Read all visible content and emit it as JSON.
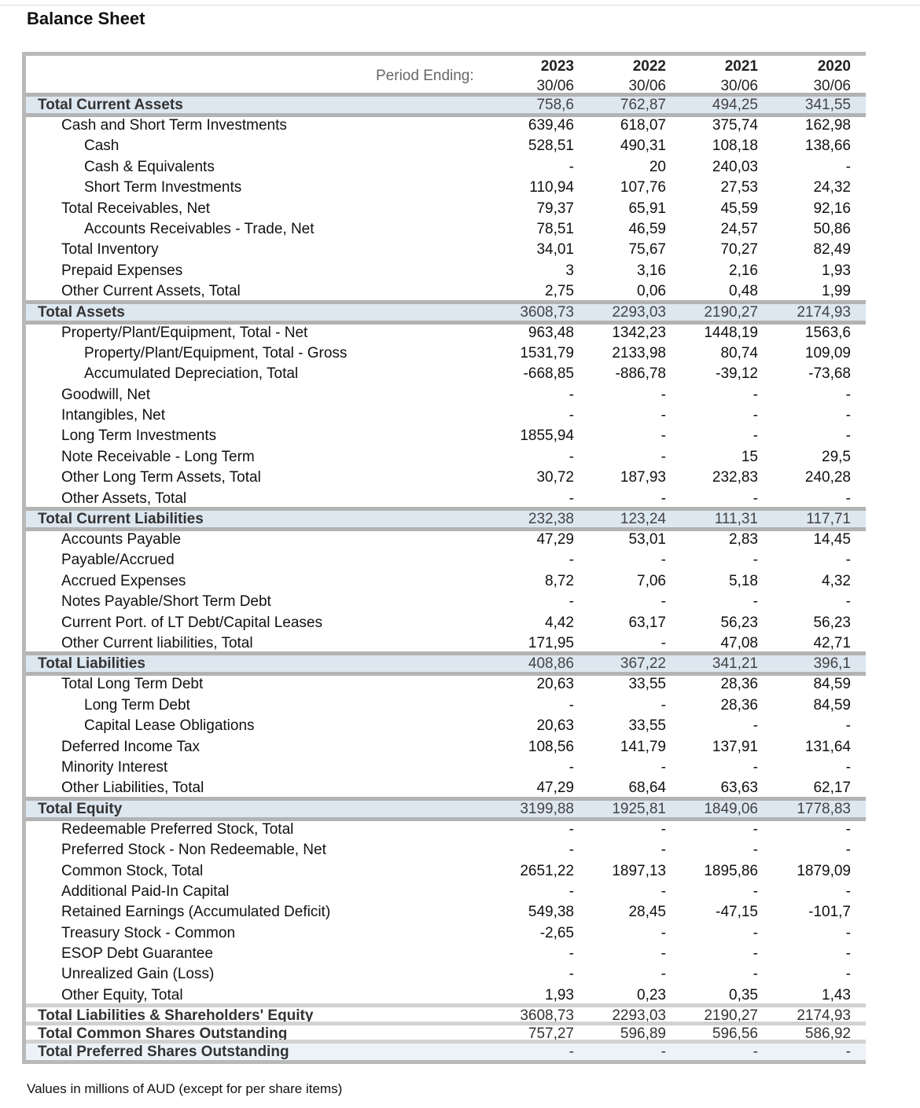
{
  "title": "Balance Sheet",
  "period_label": "Period Ending:",
  "periods": [
    {
      "year": "2023",
      "date": "30/06"
    },
    {
      "year": "2022",
      "date": "30/06"
    },
    {
      "year": "2021",
      "date": "30/06"
    },
    {
      "year": "2020",
      "date": "30/06"
    }
  ],
  "rows": [
    {
      "label": "Total Current Assets",
      "level": 0,
      "style": "sec",
      "values": [
        "758,6",
        "762,87",
        "494,25",
        "341,55"
      ]
    },
    {
      "label": "Cash and Short Term Investments",
      "level": 1,
      "values": [
        "639,46",
        "618,07",
        "375,74",
        "162,98"
      ]
    },
    {
      "label": "Cash",
      "level": 2,
      "values": [
        "528,51",
        "490,31",
        "108,18",
        "138,66"
      ]
    },
    {
      "label": "Cash & Equivalents",
      "level": 2,
      "values": [
        "-",
        "20",
        "240,03",
        "-"
      ]
    },
    {
      "label": "Short Term Investments",
      "level": 2,
      "values": [
        "110,94",
        "107,76",
        "27,53",
        "24,32"
      ]
    },
    {
      "label": "Total Receivables, Net",
      "level": 1,
      "values": [
        "79,37",
        "65,91",
        "45,59",
        "92,16"
      ]
    },
    {
      "label": "Accounts Receivables - Trade, Net",
      "level": 2,
      "values": [
        "78,51",
        "46,59",
        "24,57",
        "50,86"
      ]
    },
    {
      "label": "Total Inventory",
      "level": 1,
      "values": [
        "34,01",
        "75,67",
        "70,27",
        "82,49"
      ]
    },
    {
      "label": "Prepaid Expenses",
      "level": 1,
      "values": [
        "3",
        "3,16",
        "2,16",
        "1,93"
      ]
    },
    {
      "label": "Other Current Assets, Total",
      "level": 1,
      "values": [
        "2,75",
        "0,06",
        "0,48",
        "1,99"
      ]
    },
    {
      "label": "Total Assets",
      "level": 0,
      "style": "sec",
      "values": [
        "3608,73",
        "2293,03",
        "2190,27",
        "2174,93"
      ]
    },
    {
      "label": "Property/Plant/Equipment, Total - Net",
      "level": 1,
      "values": [
        "963,48",
        "1342,23",
        "1448,19",
        "1563,6"
      ]
    },
    {
      "label": "Property/Plant/Equipment, Total - Gross",
      "level": 2,
      "values": [
        "1531,79",
        "2133,98",
        "80,74",
        "109,09"
      ]
    },
    {
      "label": "Accumulated Depreciation, Total",
      "level": 2,
      "values": [
        "-668,85",
        "-886,78",
        "-39,12",
        "-73,68"
      ]
    },
    {
      "label": "Goodwill, Net",
      "level": 1,
      "values": [
        "-",
        "-",
        "-",
        "-"
      ]
    },
    {
      "label": "Intangibles, Net",
      "level": 1,
      "values": [
        "-",
        "-",
        "-",
        "-"
      ]
    },
    {
      "label": "Long Term Investments",
      "level": 1,
      "values": [
        "1855,94",
        "-",
        "-",
        "-"
      ]
    },
    {
      "label": "Note Receivable - Long Term",
      "level": 1,
      "values": [
        "-",
        "-",
        "15",
        "29,5"
      ]
    },
    {
      "label": "Other Long Term Assets, Total",
      "level": 1,
      "values": [
        "30,72",
        "187,93",
        "232,83",
        "240,28"
      ]
    },
    {
      "label": "Other Assets, Total",
      "level": 1,
      "values": [
        "-",
        "-",
        "-",
        "-"
      ]
    },
    {
      "label": "Total Current Liabilities",
      "level": 0,
      "style": "sec",
      "values": [
        "232,38",
        "123,24",
        "111,31",
        "117,71"
      ]
    },
    {
      "label": "Accounts Payable",
      "level": 1,
      "values": [
        "47,29",
        "53,01",
        "2,83",
        "14,45"
      ]
    },
    {
      "label": "Payable/Accrued",
      "level": 1,
      "values": [
        "-",
        "-",
        "-",
        "-"
      ]
    },
    {
      "label": "Accrued Expenses",
      "level": 1,
      "values": [
        "8,72",
        "7,06",
        "5,18",
        "4,32"
      ]
    },
    {
      "label": "Notes Payable/Short Term Debt",
      "level": 1,
      "values": [
        "-",
        "-",
        "-",
        "-"
      ]
    },
    {
      "label": "Current Port. of LT Debt/Capital Leases",
      "level": 1,
      "values": [
        "4,42",
        "63,17",
        "56,23",
        "56,23"
      ]
    },
    {
      "label": "Other Current liabilities, Total",
      "level": 1,
      "values": [
        "171,95",
        "-",
        "47,08",
        "42,71"
      ]
    },
    {
      "label": "Total Liabilities",
      "level": 0,
      "style": "sec",
      "values": [
        "408,86",
        "367,22",
        "341,21",
        "396,1"
      ]
    },
    {
      "label": "Total Long Term Debt",
      "level": 1,
      "values": [
        "20,63",
        "33,55",
        "28,36",
        "84,59"
      ]
    },
    {
      "label": "Long Term Debt",
      "level": 2,
      "values": [
        "-",
        "-",
        "28,36",
        "84,59"
      ]
    },
    {
      "label": "Capital Lease Obligations",
      "level": 2,
      "values": [
        "20,63",
        "33,55",
        "-",
        "-"
      ]
    },
    {
      "label": "Deferred Income Tax",
      "level": 1,
      "values": [
        "108,56",
        "141,79",
        "137,91",
        "131,64"
      ]
    },
    {
      "label": "Minority Interest",
      "level": 1,
      "values": [
        "-",
        "-",
        "-",
        "-"
      ]
    },
    {
      "label": "Other Liabilities, Total",
      "level": 1,
      "values": [
        "47,29",
        "68,64",
        "63,63",
        "62,17"
      ]
    },
    {
      "label": "Total Equity",
      "level": 0,
      "style": "sec",
      "values": [
        "3199,88",
        "1925,81",
        "1849,06",
        "1778,83"
      ]
    },
    {
      "label": "Redeemable Preferred Stock, Total",
      "level": 1,
      "values": [
        "-",
        "-",
        "-",
        "-"
      ]
    },
    {
      "label": "Preferred Stock - Non Redeemable, Net",
      "level": 1,
      "values": [
        "-",
        "-",
        "-",
        "-"
      ]
    },
    {
      "label": "Common Stock, Total",
      "level": 1,
      "values": [
        "2651,22",
        "1897,13",
        "1895,86",
        "1879,09"
      ]
    },
    {
      "label": "Additional Paid-In Capital",
      "level": 1,
      "values": [
        "-",
        "-",
        "-",
        "-"
      ]
    },
    {
      "label": "Retained Earnings (Accumulated Deficit)",
      "level": 1,
      "values": [
        "549,38",
        "28,45",
        "-47,15",
        "-101,7"
      ]
    },
    {
      "label": "Treasury Stock - Common",
      "level": 1,
      "values": [
        "-2,65",
        "-",
        "-",
        "-"
      ]
    },
    {
      "label": "ESOP Debt Guarantee",
      "level": 1,
      "values": [
        "-",
        "-",
        "-",
        "-"
      ]
    },
    {
      "label": "Unrealized Gain (Loss)",
      "level": 1,
      "values": [
        "-",
        "-",
        "-",
        "-"
      ]
    },
    {
      "label": "Other Equity, Total",
      "level": 1,
      "values": [
        "1,93",
        "0,23",
        "0,35",
        "1,43"
      ]
    },
    {
      "label": "Total Liabilities & Shareholders' Equity",
      "level": 0,
      "style": "grand",
      "values": [
        "3608,73",
        "2293,03",
        "2190,27",
        "2174,93"
      ]
    },
    {
      "label": "Total Common Shares Outstanding",
      "level": 0,
      "style": "grand",
      "values": [
        "757,27",
        "596,89",
        "596,56",
        "586,92"
      ]
    },
    {
      "label": "Total Preferred Shares Outstanding",
      "level": 0,
      "style": "grand last",
      "values": [
        "-",
        "-",
        "-",
        "-"
      ]
    }
  ],
  "footnote": "Values in millions of AUD (except for per share items)",
  "colors": {
    "section_bg": "#dde7f0",
    "border": "#b9b9b9"
  }
}
